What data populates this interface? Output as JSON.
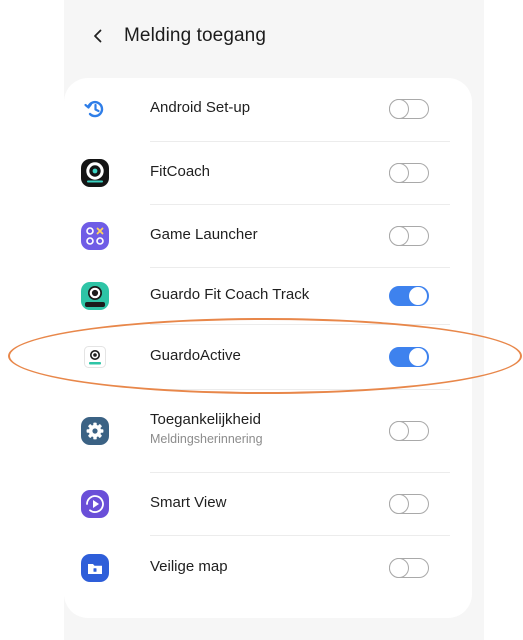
{
  "header": {
    "title": "Melding toegang",
    "back_icon": "chevron-left-icon"
  },
  "apps": [
    {
      "label": "Android Set-up",
      "sublabel": "",
      "icon": "android-setup-icon",
      "enabled": false
    },
    {
      "label": "FitCoach",
      "sublabel": "",
      "icon": "fitcoach-icon",
      "enabled": false
    },
    {
      "label": "Game Launcher",
      "sublabel": "",
      "icon": "game-launcher-icon",
      "enabled": false
    },
    {
      "label": "Guardo Fit Coach Track",
      "sublabel": "",
      "icon": "guardo-fit-coach-track-icon",
      "enabled": true
    },
    {
      "label": "GuardoActive",
      "sublabel": "",
      "icon": "guardoactive-icon",
      "enabled": true
    },
    {
      "label": "Toegankelijkheid",
      "sublabel": "Meldingsherinnering",
      "icon": "accessibility-gear-icon",
      "enabled": false
    },
    {
      "label": "Smart View",
      "sublabel": "",
      "icon": "smart-view-icon",
      "enabled": false
    },
    {
      "label": "Veilige map",
      "sublabel": "",
      "icon": "secure-folder-icon",
      "enabled": false
    }
  ],
  "colors": {
    "accent": "#3e82ee",
    "highlight": "#e8874a",
    "toggle_off": "#a9a9a9"
  }
}
